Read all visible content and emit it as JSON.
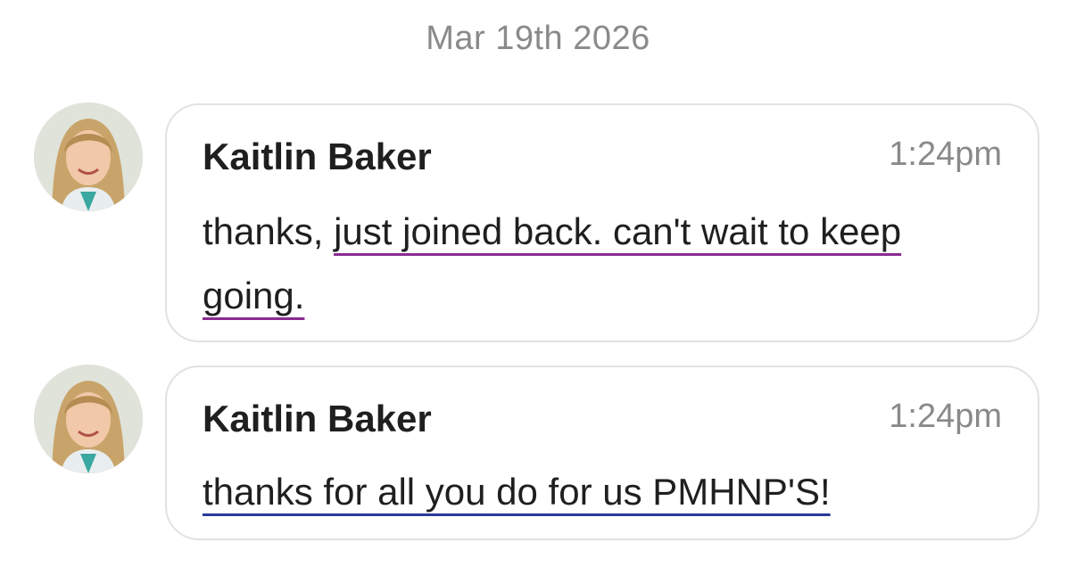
{
  "date_separator": "Mar 19th 2026",
  "messages": [
    {
      "sender": "Kaitlin Baker",
      "time": "1:24pm",
      "text_plain": "thanks, ",
      "text_marked": "just joined back. can't wait to keep going."
    },
    {
      "sender": "Kaitlin Baker",
      "time": "1:24pm",
      "text_plain": "",
      "text_marked": "thanks for all you do for us PMHNP'S!"
    }
  ],
  "colors": {
    "underline_message_1": "#8a2c8f",
    "underline_message_2": "#2a3a9a",
    "bubble_border": "#e2e2e2",
    "muted_text": "#8a8a8a"
  }
}
